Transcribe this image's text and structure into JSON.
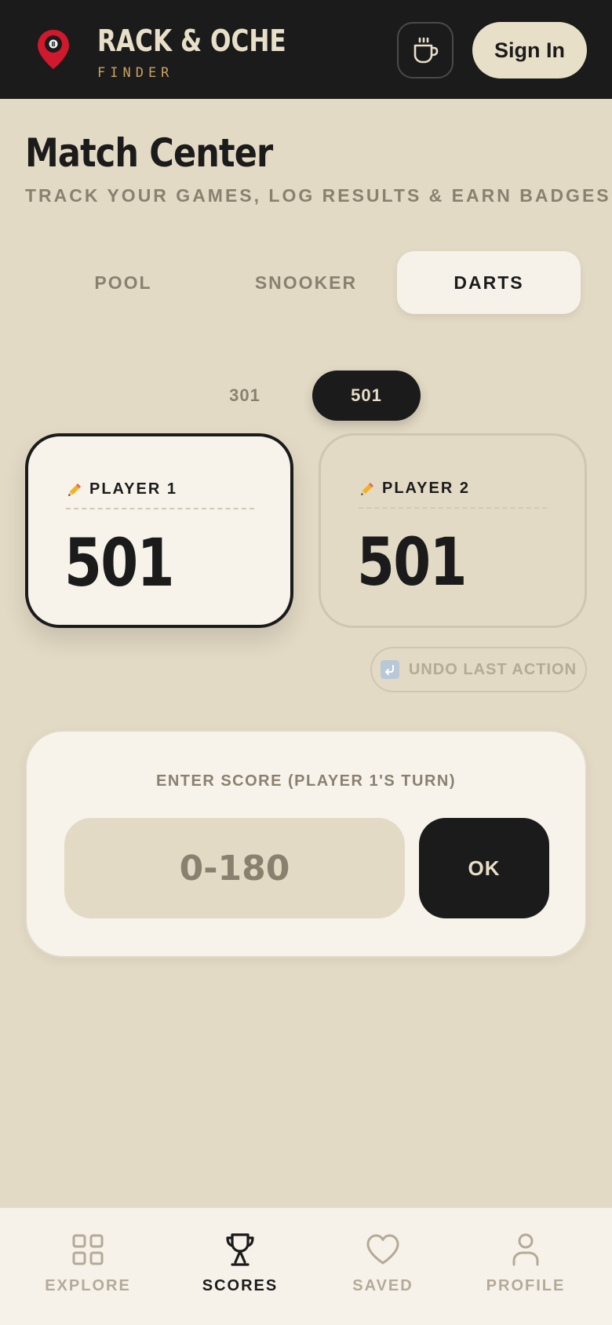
{
  "header": {
    "brand_title": "RACK & OCHE",
    "brand_subtitle": "FINDER",
    "sign_in_label": "Sign In",
    "pin_number": "8"
  },
  "page": {
    "title": "Match Center",
    "subtitle": "TRACK YOUR GAMES, LOG RESULTS & EARN BADGES."
  },
  "tabs": [
    {
      "label": "POOL",
      "active": false
    },
    {
      "label": "SNOOKER",
      "active": false
    },
    {
      "label": "DARTS",
      "active": true
    }
  ],
  "modes": [
    {
      "label": "301",
      "active": false
    },
    {
      "label": "501",
      "active": true
    }
  ],
  "players": [
    {
      "name": "PLAYER 1",
      "score": "501",
      "active": true
    },
    {
      "name": "PLAYER 2",
      "score": "501",
      "active": false
    }
  ],
  "undo_label": "UNDO LAST ACTION",
  "score_entry": {
    "prompt": "ENTER SCORE (PLAYER 1'S TURN)",
    "placeholder": "0-180",
    "ok_label": "OK"
  },
  "bottom_nav": [
    {
      "label": "EXPLORE",
      "icon": "grid-icon",
      "active": false
    },
    {
      "label": "SCORES",
      "icon": "trophy-icon",
      "active": true
    },
    {
      "label": "SAVED",
      "icon": "heart-icon",
      "active": false
    },
    {
      "label": "PROFILE",
      "icon": "user-icon",
      "active": false
    }
  ],
  "colors": {
    "background": "#e3dac5",
    "header": "#1b1b1b",
    "accent_gold": "#c9a262",
    "pin_red": "#d0192c",
    "card": "#f7f3eb"
  }
}
